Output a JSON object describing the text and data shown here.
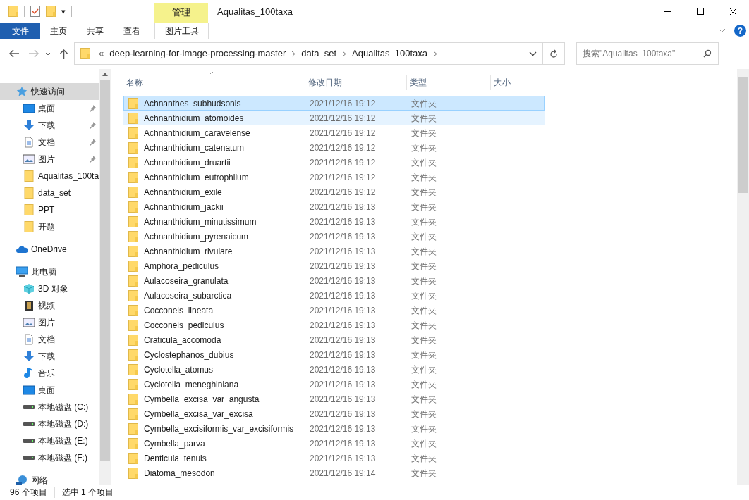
{
  "window": {
    "title": "Aqualitas_100taxa",
    "context_group": "管理",
    "help_glyph": "?"
  },
  "quick_access_toolbar": {
    "customize_glyph": "▾"
  },
  "ribbon_tabs": [
    {
      "label": "文件",
      "kind": "file",
      "selected": false
    },
    {
      "label": "主页",
      "kind": "tab",
      "selected": false
    },
    {
      "label": "共享",
      "kind": "tab",
      "selected": false
    },
    {
      "label": "查看",
      "kind": "tab",
      "selected": false
    },
    {
      "label": "图片工具",
      "kind": "context",
      "selected": false
    }
  ],
  "address_bar": {
    "overflow": "«",
    "segments": [
      "deep-learning-for-image-processing-master",
      "data_set",
      "Aqualitas_100taxa"
    ]
  },
  "search": {
    "placeholder": "搜索\"Aqualitas_100taxa\""
  },
  "sidebar": [
    {
      "label": "快速访问",
      "kind": "star",
      "selected": true,
      "items": [
        {
          "label": "桌面",
          "kind": "desktop",
          "pinned": true
        },
        {
          "label": "下载",
          "kind": "download",
          "pinned": true
        },
        {
          "label": "文档",
          "kind": "document",
          "pinned": true
        },
        {
          "label": "图片",
          "kind": "picture",
          "pinned": true
        },
        {
          "label": "Aqualitas_100ta",
          "kind": "folder",
          "pinned": false
        },
        {
          "label": "data_set",
          "kind": "folder",
          "pinned": false
        },
        {
          "label": "PPT",
          "kind": "folder",
          "pinned": false
        },
        {
          "label": "开题",
          "kind": "folder",
          "pinned": false
        }
      ]
    },
    {
      "label": "OneDrive",
      "kind": "cloud",
      "selected": false
    },
    {
      "label": "此电脑",
      "kind": "computer",
      "selected": false,
      "items": [
        {
          "label": "3D 对象",
          "kind": "cube",
          "pinned": false
        },
        {
          "label": "视频",
          "kind": "video",
          "pinned": false
        },
        {
          "label": "图片",
          "kind": "picture",
          "pinned": false
        },
        {
          "label": "文档",
          "kind": "document",
          "pinned": false
        },
        {
          "label": "下载",
          "kind": "download",
          "pinned": false
        },
        {
          "label": "音乐",
          "kind": "music",
          "pinned": false
        },
        {
          "label": "桌面",
          "kind": "desktop",
          "pinned": false
        },
        {
          "label": "本地磁盘 (C:)",
          "kind": "drive",
          "pinned": false
        },
        {
          "label": "本地磁盘 (D:)",
          "kind": "drive",
          "pinned": false
        },
        {
          "label": "本地磁盘 (E:)",
          "kind": "drive",
          "pinned": false
        },
        {
          "label": "本地磁盘 (F:)",
          "kind": "drive",
          "pinned": false
        }
      ]
    },
    {
      "label": "网络",
      "kind": "network",
      "selected": false
    }
  ],
  "table": {
    "columns": [
      "名称",
      "修改日期",
      "类型",
      "大小"
    ],
    "rows": [
      {
        "name": "Achnanthes_subhudsonis",
        "date": "2021/12/16 19:12",
        "type": "文件夹",
        "selected": true,
        "hovered": false
      },
      {
        "name": "Achnanthidium_atomoides",
        "date": "2021/12/16 19:12",
        "type": "文件夹",
        "selected": false,
        "hovered": true
      },
      {
        "name": "Achnanthidium_caravelense",
        "date": "2021/12/16 19:12",
        "type": "文件夹",
        "selected": false,
        "hovered": false
      },
      {
        "name": "Achnanthidium_catenatum",
        "date": "2021/12/16 19:12",
        "type": "文件夹",
        "selected": false,
        "hovered": false
      },
      {
        "name": "Achnanthidium_druartii",
        "date": "2021/12/16 19:12",
        "type": "文件夹",
        "selected": false,
        "hovered": false
      },
      {
        "name": "Achnanthidium_eutrophilum",
        "date": "2021/12/16 19:12",
        "type": "文件夹",
        "selected": false,
        "hovered": false
      },
      {
        "name": "Achnanthidium_exile",
        "date": "2021/12/16 19:12",
        "type": "文件夹",
        "selected": false,
        "hovered": false
      },
      {
        "name": "Achnanthidium_jackii",
        "date": "2021/12/16 19:13",
        "type": "文件夹",
        "selected": false,
        "hovered": false
      },
      {
        "name": "Achnanthidium_minutissimum",
        "date": "2021/12/16 19:13",
        "type": "文件夹",
        "selected": false,
        "hovered": false
      },
      {
        "name": "Achnanthidium_pyrenaicum",
        "date": "2021/12/16 19:13",
        "type": "文件夹",
        "selected": false,
        "hovered": false
      },
      {
        "name": "Achnanthidium_rivulare",
        "date": "2021/12/16 19:13",
        "type": "文件夹",
        "selected": false,
        "hovered": false
      },
      {
        "name": "Amphora_pediculus",
        "date": "2021/12/16 19:13",
        "type": "文件夹",
        "selected": false,
        "hovered": false
      },
      {
        "name": "Aulacoseira_granulata",
        "date": "2021/12/16 19:13",
        "type": "文件夹",
        "selected": false,
        "hovered": false
      },
      {
        "name": "Aulacoseira_subarctica",
        "date": "2021/12/16 19:13",
        "type": "文件夹",
        "selected": false,
        "hovered": false
      },
      {
        "name": "Cocconeis_lineata",
        "date": "2021/12/16 19:13",
        "type": "文件夹",
        "selected": false,
        "hovered": false
      },
      {
        "name": "Cocconeis_pediculus",
        "date": "2021/12/16 19:13",
        "type": "文件夹",
        "selected": false,
        "hovered": false
      },
      {
        "name": "Craticula_accomoda",
        "date": "2021/12/16 19:13",
        "type": "文件夹",
        "selected": false,
        "hovered": false
      },
      {
        "name": "Cyclostephanos_dubius",
        "date": "2021/12/16 19:13",
        "type": "文件夹",
        "selected": false,
        "hovered": false
      },
      {
        "name": "Cyclotella_atomus",
        "date": "2021/12/16 19:13",
        "type": "文件夹",
        "selected": false,
        "hovered": false
      },
      {
        "name": "Cyclotella_meneghiniana",
        "date": "2021/12/16 19:13",
        "type": "文件夹",
        "selected": false,
        "hovered": false
      },
      {
        "name": "Cymbella_excisa_var_angusta",
        "date": "2021/12/16 19:13",
        "type": "文件夹",
        "selected": false,
        "hovered": false
      },
      {
        "name": "Cymbella_excisa_var_excisa",
        "date": "2021/12/16 19:13",
        "type": "文件夹",
        "selected": false,
        "hovered": false
      },
      {
        "name": "Cymbella_excisiformis_var_excisiformis",
        "date": "2021/12/16 19:13",
        "type": "文件夹",
        "selected": false,
        "hovered": false
      },
      {
        "name": "Cymbella_parva",
        "date": "2021/12/16 19:13",
        "type": "文件夹",
        "selected": false,
        "hovered": false
      },
      {
        "name": "Denticula_tenuis",
        "date": "2021/12/16 19:13",
        "type": "文件夹",
        "selected": false,
        "hovered": false
      },
      {
        "name": "Diatoma_mesodon",
        "date": "2021/12/16 19:14",
        "type": "文件夹",
        "selected": false,
        "hovered": false
      }
    ]
  },
  "status_bar": {
    "count": "96 个项目",
    "selection": "选中 1 个项目"
  }
}
